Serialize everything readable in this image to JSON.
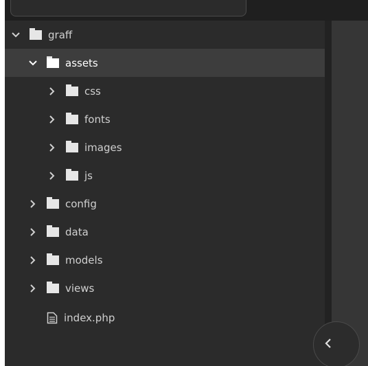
{
  "tree": {
    "items": [
      {
        "label": "graff",
        "type": "folder",
        "expanded": true,
        "selected": false,
        "level": 0
      },
      {
        "label": "assets",
        "type": "folder",
        "expanded": true,
        "selected": true,
        "level": 1
      },
      {
        "label": "css",
        "type": "folder",
        "expanded": false,
        "selected": false,
        "level": 2
      },
      {
        "label": "fonts",
        "type": "folder",
        "expanded": false,
        "selected": false,
        "level": 2
      },
      {
        "label": "images",
        "type": "folder",
        "expanded": false,
        "selected": false,
        "level": 2
      },
      {
        "label": "js",
        "type": "folder",
        "expanded": false,
        "selected": false,
        "level": 2
      },
      {
        "label": "config",
        "type": "folder",
        "expanded": false,
        "selected": false,
        "level": 1
      },
      {
        "label": "data",
        "type": "folder",
        "expanded": false,
        "selected": false,
        "level": 1
      },
      {
        "label": "models",
        "type": "folder",
        "expanded": false,
        "selected": false,
        "level": 1
      },
      {
        "label": "views",
        "type": "folder",
        "expanded": false,
        "selected": false,
        "level": 1
      },
      {
        "label": "index.php",
        "type": "file",
        "selected": false,
        "level": 1
      }
    ]
  },
  "colors": {
    "background": "#2b2b2b",
    "selected_row": "#3d3d3d",
    "text": "#d0d0d0",
    "icon": "#e6e6e6"
  },
  "icons": {
    "expanded": "chevron-down-icon",
    "collapsed": "chevron-right-icon",
    "folder": "folder-icon",
    "file": "file-text-icon",
    "collapse_panel": "chevron-left-icon"
  }
}
